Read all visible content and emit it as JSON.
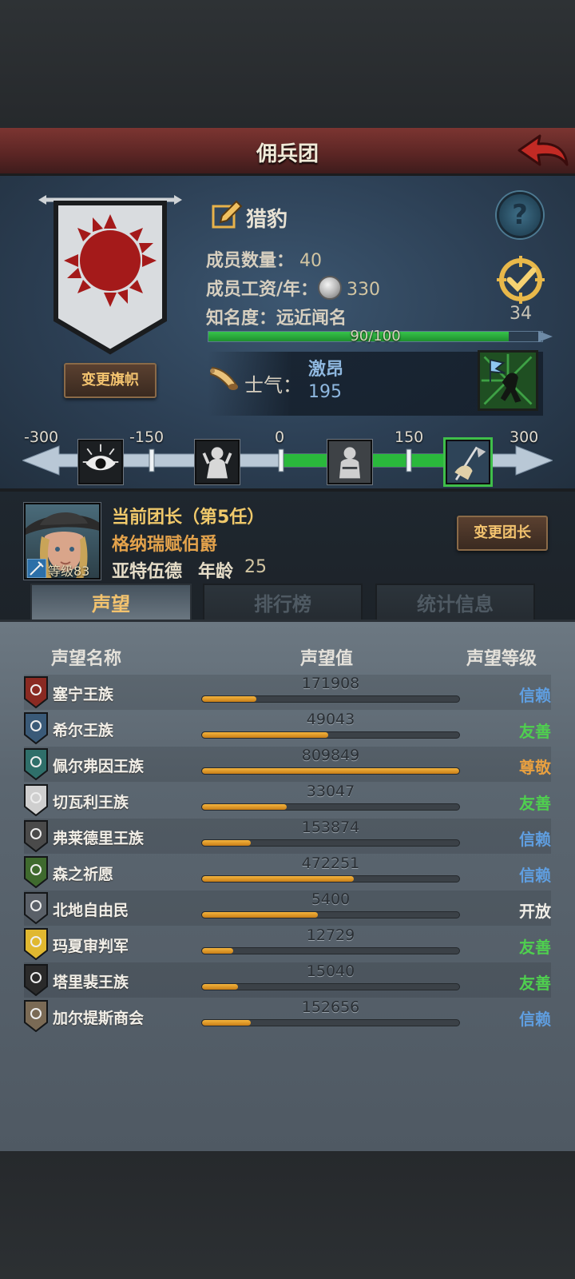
{
  "header": {
    "title": "佣兵团"
  },
  "guild": {
    "name": "猎豹",
    "change_banner_label": "变更旗帜",
    "members_label": "成员数量：",
    "members_value": "40",
    "wage_label": "成员工资/年：",
    "wage_value": "330",
    "fame_label": "知名度：",
    "fame_state": "远近闻名",
    "fame_progress_text": "90/100",
    "fame_progress": 0.9,
    "medal_count": "34",
    "morale_label": "士气：",
    "morale_state": "激昂",
    "morale_value": "195"
  },
  "morale_scale": {
    "labels": [
      "-300",
      "-150",
      "0",
      "150",
      "300"
    ],
    "icons": [
      "eye-icon",
      "distressed-figure-icon",
      "neutral-figure-icon",
      "cheering-flag-icon"
    ],
    "active_index": 3
  },
  "leader": {
    "title": "当前团长（第5任）",
    "rank": "格纳瑞赋伯爵",
    "name": "亚特伍德",
    "age_label": "年龄",
    "age": "25",
    "level_text": "等级83",
    "change_leader_label": "变更团长"
  },
  "tabs": [
    {
      "label": "声望",
      "active": true
    },
    {
      "label": "排行榜",
      "active": false
    },
    {
      "label": "统计信息",
      "active": false
    }
  ],
  "reputation": {
    "headers": {
      "name": "声望名称",
      "value": "声望值",
      "level": "声望等级"
    },
    "rows": [
      {
        "name": "塞宁王族",
        "value": "171908",
        "fill": 0.21,
        "level": "信赖",
        "level_color": "#5f9ee0",
        "shield": "#8a2a22"
      },
      {
        "name": "希尔王族",
        "value": "49043",
        "fill": 0.49,
        "level": "友善",
        "level_color": "#4fcf4f",
        "shield": "#3a5a78"
      },
      {
        "name": "佩尔弗因王族",
        "value": "809849",
        "fill": 1.0,
        "level": "尊敬",
        "level_color": "#e8a040",
        "shield": "#2f6f6a"
      },
      {
        "name": "切瓦利王族",
        "value": "33047",
        "fill": 0.33,
        "level": "友善",
        "level_color": "#4fcf4f",
        "shield": "#cfcfcf"
      },
      {
        "name": "弗莱德里王族",
        "value": "153874",
        "fill": 0.19,
        "level": "信赖",
        "level_color": "#5f9ee0",
        "shield": "#4a4a4a"
      },
      {
        "name": "森之祈愿",
        "value": "472251",
        "fill": 0.59,
        "level": "信赖",
        "level_color": "#5f9ee0",
        "shield": "#3f6a2e"
      },
      {
        "name": "北地自由民",
        "value": "5400",
        "fill": 0.45,
        "level": "开放",
        "level_color": "#f2efe8",
        "shield": "#5a6068"
      },
      {
        "name": "玛夏审判军",
        "value": "12729",
        "fill": 0.12,
        "level": "友善",
        "level_color": "#4fcf4f",
        "shield": "#e0b830"
      },
      {
        "name": "塔里裴王族",
        "value": "15040",
        "fill": 0.14,
        "level": "友善",
        "level_color": "#4fcf4f",
        "shield": "#2a2a2a"
      },
      {
        "name": "加尔提斯商会",
        "value": "152656",
        "fill": 0.19,
        "level": "信赖",
        "level_color": "#5f9ee0",
        "shield": "#7a6a55"
      }
    ]
  },
  "colors": {
    "accent": "#f3c36f",
    "header_red": "#7c3531",
    "green": "#36c44a",
    "orange": "#f4b43d"
  }
}
